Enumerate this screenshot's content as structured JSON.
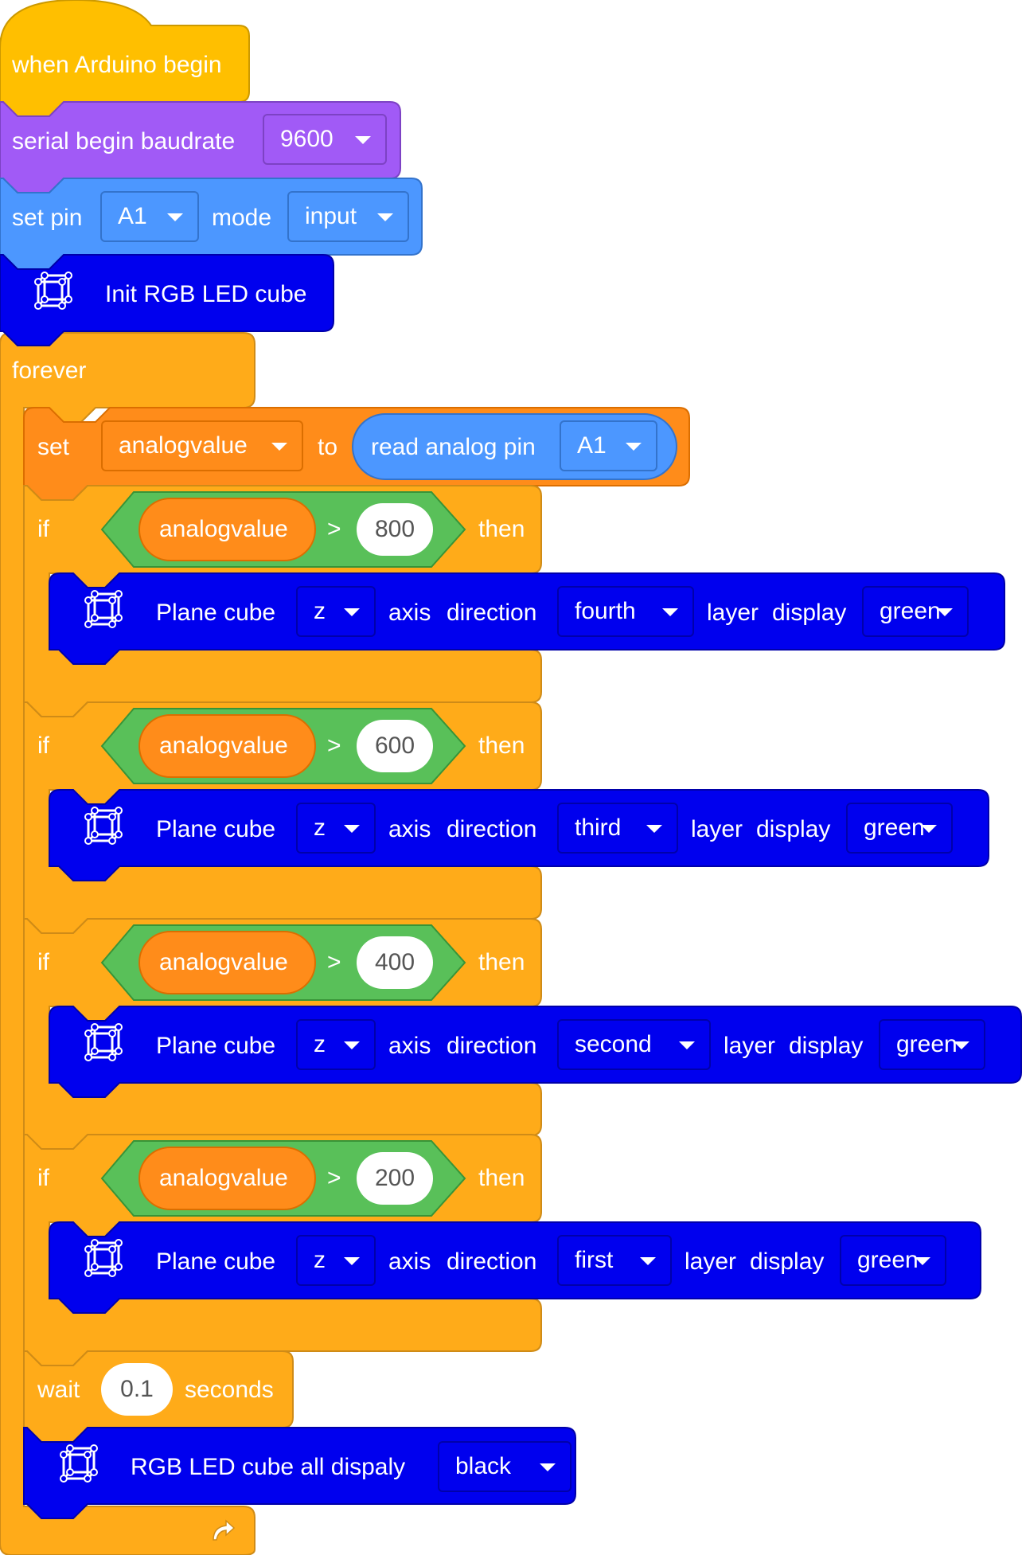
{
  "colors": {
    "events": "#FFBF00",
    "serial": "#A15AF6",
    "pins": "#4C97FF",
    "cube": "#0000EE",
    "control": "#FFAB19",
    "variables": "#FF8C1A",
    "operators": "#59C059",
    "loop_arrow": "#ffffff"
  },
  "start": {
    "label": "when Arduino begin"
  },
  "serial": {
    "label": "serial begin baudrate",
    "baud": "9600"
  },
  "pinmode": {
    "label1": "set pin",
    "pin": "A1",
    "label2": "mode",
    "mode": "input"
  },
  "init": {
    "label": "Init RGB LED cube"
  },
  "forever": {
    "label": "forever"
  },
  "setvar": {
    "label": "set",
    "var": "analogvalue",
    "to": "to",
    "read": "read analog pin",
    "pin": "A1"
  },
  "conditions": [
    {
      "if": "if",
      "var": "analogvalue",
      "op": ">",
      "value": "800",
      "then": "then",
      "plane": "Plane cube",
      "axis": "z",
      "axis_label": "axis",
      "direction_label": "direction",
      "layer": "fourth",
      "layer_label": "layer",
      "display_label": "display",
      "color": "green"
    },
    {
      "if": "if",
      "var": "analogvalue",
      "op": ">",
      "value": "600",
      "then": "then",
      "plane": "Plane cube",
      "axis": "z",
      "axis_label": "axis",
      "direction_label": "direction",
      "layer": "third",
      "layer_label": "layer",
      "display_label": "display",
      "color": "green"
    },
    {
      "if": "if",
      "var": "analogvalue",
      "op": ">",
      "value": "400",
      "then": "then",
      "plane": "Plane cube",
      "axis": "z",
      "axis_label": "axis",
      "direction_label": "direction",
      "layer": "second",
      "layer_label": "layer",
      "display_label": "display",
      "color": "green"
    },
    {
      "if": "if",
      "var": "analogvalue",
      "op": ">",
      "value": "200",
      "then": "then",
      "plane": "Plane cube",
      "axis": "z",
      "axis_label": "axis",
      "direction_label": "direction",
      "layer": "first",
      "layer_label": "layer",
      "display_label": "display",
      "color": "green"
    }
  ],
  "wait": {
    "label": "wait",
    "value": "0.1",
    "unit": "seconds"
  },
  "alldisplay": {
    "label": "RGB LED cube all dispaly",
    "color": "black"
  },
  "icons": {
    "cube": "led-cube-icon",
    "loop": "loop-arrow-icon",
    "dropdown": "caret-down-icon"
  }
}
